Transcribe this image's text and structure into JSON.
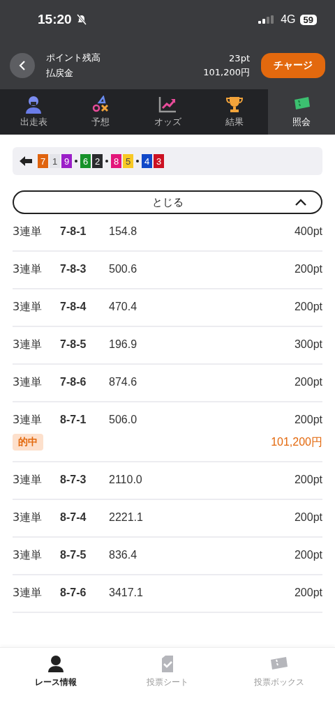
{
  "status_bar": {
    "time": "15:20",
    "network": "4G",
    "battery": "59"
  },
  "header": {
    "balance_label": "ポイント残高",
    "balance": "23pt",
    "refund_label": "払戻金",
    "refund": "101,200円",
    "charge_button": "チャージ"
  },
  "tabs": [
    {
      "label": "出走表",
      "selected": false
    },
    {
      "label": "予想",
      "selected": false
    },
    {
      "label": "オッズ",
      "selected": false
    },
    {
      "label": "結果",
      "selected": false
    },
    {
      "label": "照会",
      "selected": true
    }
  ],
  "order": {
    "groups": [
      [
        {
          "label": "7",
          "color": "#e0640f"
        },
        {
          "label": "1",
          "color": "#e4e5ea"
        },
        {
          "label": "9",
          "color": "#9b1fc8"
        }
      ],
      [
        {
          "label": "6",
          "color": "#16922a"
        },
        {
          "label": "2",
          "color": "#2a2b2e"
        }
      ],
      [
        {
          "label": "8",
          "color": "#e3167a"
        },
        {
          "label": "5",
          "color": "#f8c924"
        }
      ],
      [
        {
          "label": "4",
          "color": "#1148c8"
        },
        {
          "label": "3",
          "color": "#cc1122"
        }
      ]
    ]
  },
  "close_button": {
    "label": "とじる",
    "expanded": true
  },
  "bets": [
    {
      "type": "3連単",
      "combo": "7-8-1",
      "odds": "154.8",
      "amount": "400pt",
      "hit": false
    },
    {
      "type": "3連単",
      "combo": "7-8-3",
      "odds": "500.6",
      "amount": "200pt",
      "hit": false
    },
    {
      "type": "3連単",
      "combo": "7-8-4",
      "odds": "470.4",
      "amount": "200pt",
      "hit": false
    },
    {
      "type": "3連単",
      "combo": "7-8-5",
      "odds": "196.9",
      "amount": "300pt",
      "hit": false
    },
    {
      "type": "3連単",
      "combo": "7-8-6",
      "odds": "874.6",
      "amount": "200pt",
      "hit": false
    },
    {
      "type": "3連単",
      "combo": "8-7-1",
      "odds": "506.0",
      "amount": "200pt",
      "hit": true,
      "hit_label": "的中",
      "payout": "101,200円"
    },
    {
      "type": "3連単",
      "combo": "8-7-3",
      "odds": "2110.0",
      "amount": "200pt",
      "hit": false
    },
    {
      "type": "3連単",
      "combo": "8-7-4",
      "odds": "2221.1",
      "amount": "200pt",
      "hit": false
    },
    {
      "type": "3連単",
      "combo": "8-7-5",
      "odds": "836.4",
      "amount": "200pt",
      "hit": false
    },
    {
      "type": "3連単",
      "combo": "8-7-6",
      "odds": "3417.1",
      "amount": "200pt",
      "hit": false
    }
  ],
  "bottom_nav": [
    {
      "label": "レース情報",
      "selected": true
    },
    {
      "label": "投票シート",
      "selected": false
    },
    {
      "label": "投票ボックス",
      "selected": false
    }
  ]
}
